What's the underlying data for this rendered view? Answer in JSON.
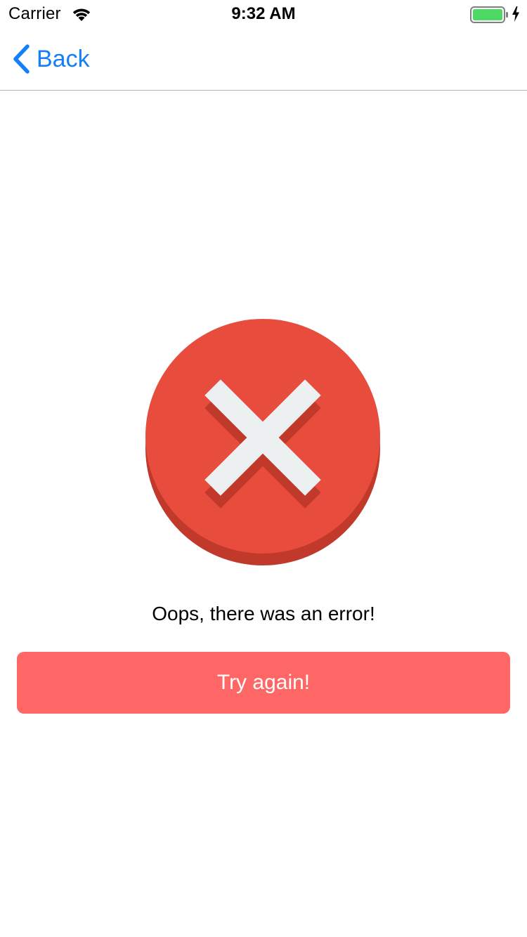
{
  "status_bar": {
    "carrier": "Carrier",
    "time": "9:32 AM",
    "battery_color": "#4cd964"
  },
  "nav": {
    "back_label": "Back",
    "accent_color": "#147efb"
  },
  "error": {
    "icon": "error-x-icon",
    "circle_color": "#e74c3c",
    "message": "Oops, there was an error!"
  },
  "retry_button": {
    "label": "Try again!",
    "color": "#ff6666"
  }
}
